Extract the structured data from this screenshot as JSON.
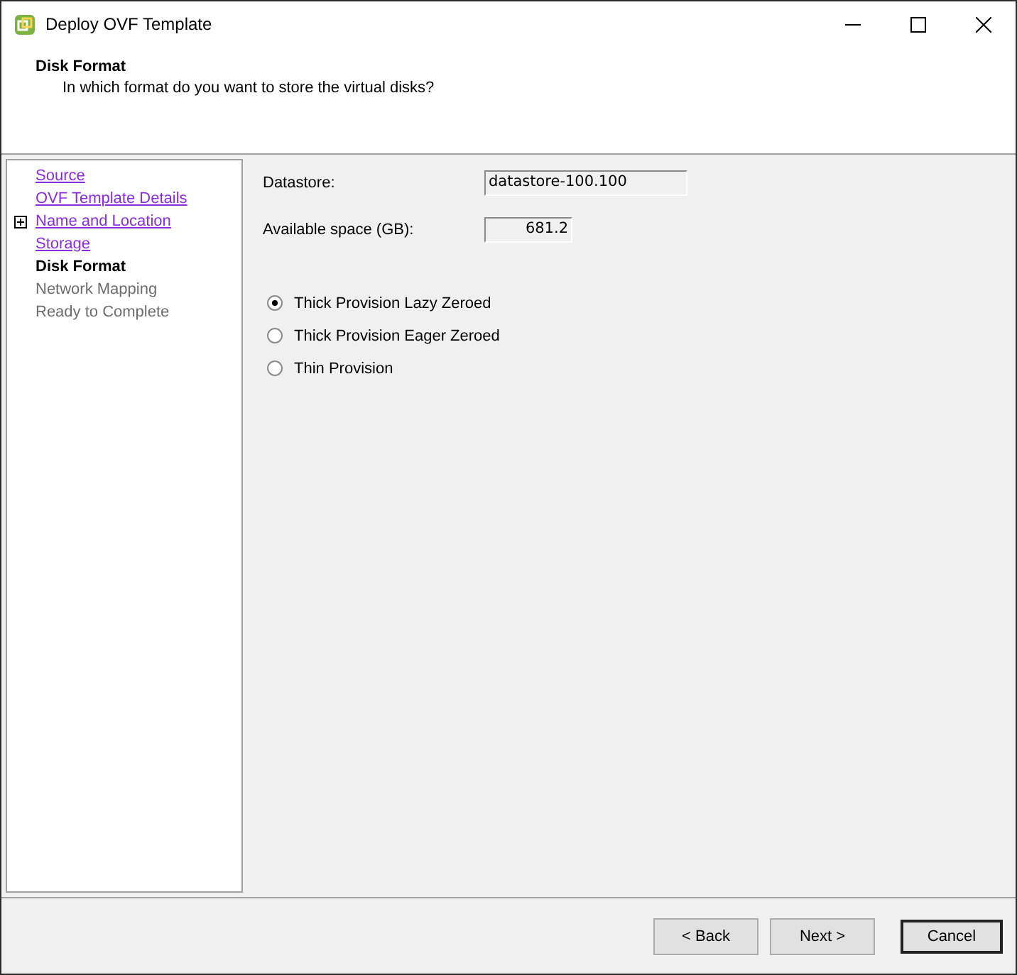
{
  "window": {
    "title": "Deploy OVF Template"
  },
  "header": {
    "title": "Disk Format",
    "subtitle": "In which format do you want to store the virtual disks?"
  },
  "steps": [
    {
      "label": "Source",
      "kind": "link",
      "selected": false
    },
    {
      "label": "OVF Template Details",
      "kind": "link",
      "selected": false
    },
    {
      "label": "Name and Location",
      "kind": "link",
      "selected": false,
      "expandable": true
    },
    {
      "label": "Storage",
      "kind": "link",
      "selected": false
    },
    {
      "label": "Disk Format",
      "kind": "current",
      "selected": true
    },
    {
      "label": "Network Mapping",
      "kind": "pending",
      "selected": false
    },
    {
      "label": "Ready to Complete",
      "kind": "pending",
      "selected": false
    }
  ],
  "fields": [
    {
      "label": "Datastore:",
      "value": "datastore-100.100",
      "kind": "text"
    },
    {
      "label": "Available space (GB):",
      "value": "681.2",
      "kind": "number"
    }
  ],
  "options": [
    {
      "label": "Thick Provision Lazy Zeroed",
      "selected": true
    },
    {
      "label": "Thick Provision Eager Zeroed",
      "selected": false
    },
    {
      "label": "Thin Provision",
      "selected": false
    }
  ],
  "buttons": [
    {
      "label": "< Back",
      "default": false
    },
    {
      "label": "Next >",
      "default": false
    },
    {
      "label": "Cancel",
      "default": true
    }
  ]
}
